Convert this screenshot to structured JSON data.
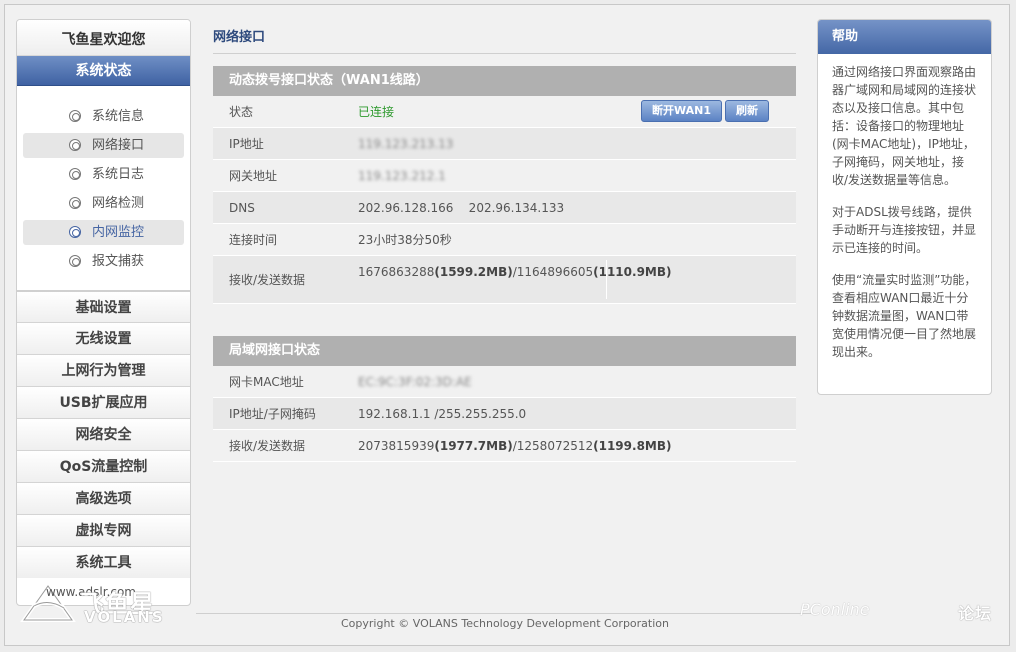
{
  "sidebar": {
    "brand": "飞鱼星欢迎您",
    "active_section": "系统状态",
    "sub_items": [
      {
        "label": "系统信息"
      },
      {
        "label": "网络接口"
      },
      {
        "label": "系统日志"
      },
      {
        "label": "网络检测"
      },
      {
        "label": "内网监控"
      },
      {
        "label": "报文捕获"
      }
    ],
    "sections": [
      {
        "label": "基础设置"
      },
      {
        "label": "无线设置"
      },
      {
        "label": "上网行为管理"
      },
      {
        "label": "USB扩展应用"
      },
      {
        "label": "网络安全"
      },
      {
        "label": "QoS流量控制"
      },
      {
        "label": "高级选项"
      },
      {
        "label": "虚拟专网"
      },
      {
        "label": "系统工具"
      }
    ],
    "site_url": "www.adslr.com",
    "logo_text": "飞鱼星",
    "logo_sub": "VOLANS"
  },
  "main": {
    "page_title": "网络接口",
    "wan": {
      "header": "动态拨号接口状态（WAN1线路）",
      "status_key": "状态",
      "status_val": "已连接",
      "disconnect_button": "断开WAN1",
      "refresh_button": "刷新",
      "ip_key": "IP地址",
      "ip_val": "119.123.213.13",
      "gateway_key": "网关地址",
      "gateway_val": "119.123.212.1",
      "dns_key": "DNS",
      "dns_val": "202.96.128.166    202.96.134.133",
      "uptime_key": "连接时间",
      "uptime_val": "23小时38分50秒",
      "traffic_key": "接收/发送数据",
      "traffic_rx": "1676863288",
      "traffic_rx_h": "(1599.2MB)",
      "traffic_tx": "/1164896605",
      "traffic_tx_h": "(1110.9MB)"
    },
    "lan": {
      "header": "局域网接口状态",
      "mac_key": "网卡MAC地址",
      "mac_val": "EC:9C:3F:02:3D:AE",
      "ip_key": "IP地址/子网掩码",
      "ip_val": "192.168.1.1 /255.255.255.0",
      "traffic_key": "接收/发送数据",
      "traffic_rx": "2073815939",
      "traffic_rx_h": "(1977.7MB)",
      "traffic_tx": "/1258072512",
      "traffic_tx_h": "(1199.8MB)"
    }
  },
  "help": {
    "title": "帮助",
    "p1": "通过网络接口界面观察路由器广域网和局域网的连接状态以及接口信息。其中包括：设备接口的物理地址(网卡MAC地址)，IP地址，子网掩码，网关地址，接收/发送数据量等信息。",
    "p2": "对于ADSL拨号线路，提供手动断开与连接按钮，并显示已连接的时间。",
    "p3": "使用“流量实时监测”功能，查看相应WAN口最近十分钟数据流量图，WAN口带宽使用情况便一目了然地展现出来。"
  },
  "footer": {
    "copyright": "Copyright © VOLANS Technology Development Corporation",
    "watermark": "PConline",
    "watermark2": "论坛"
  }
}
